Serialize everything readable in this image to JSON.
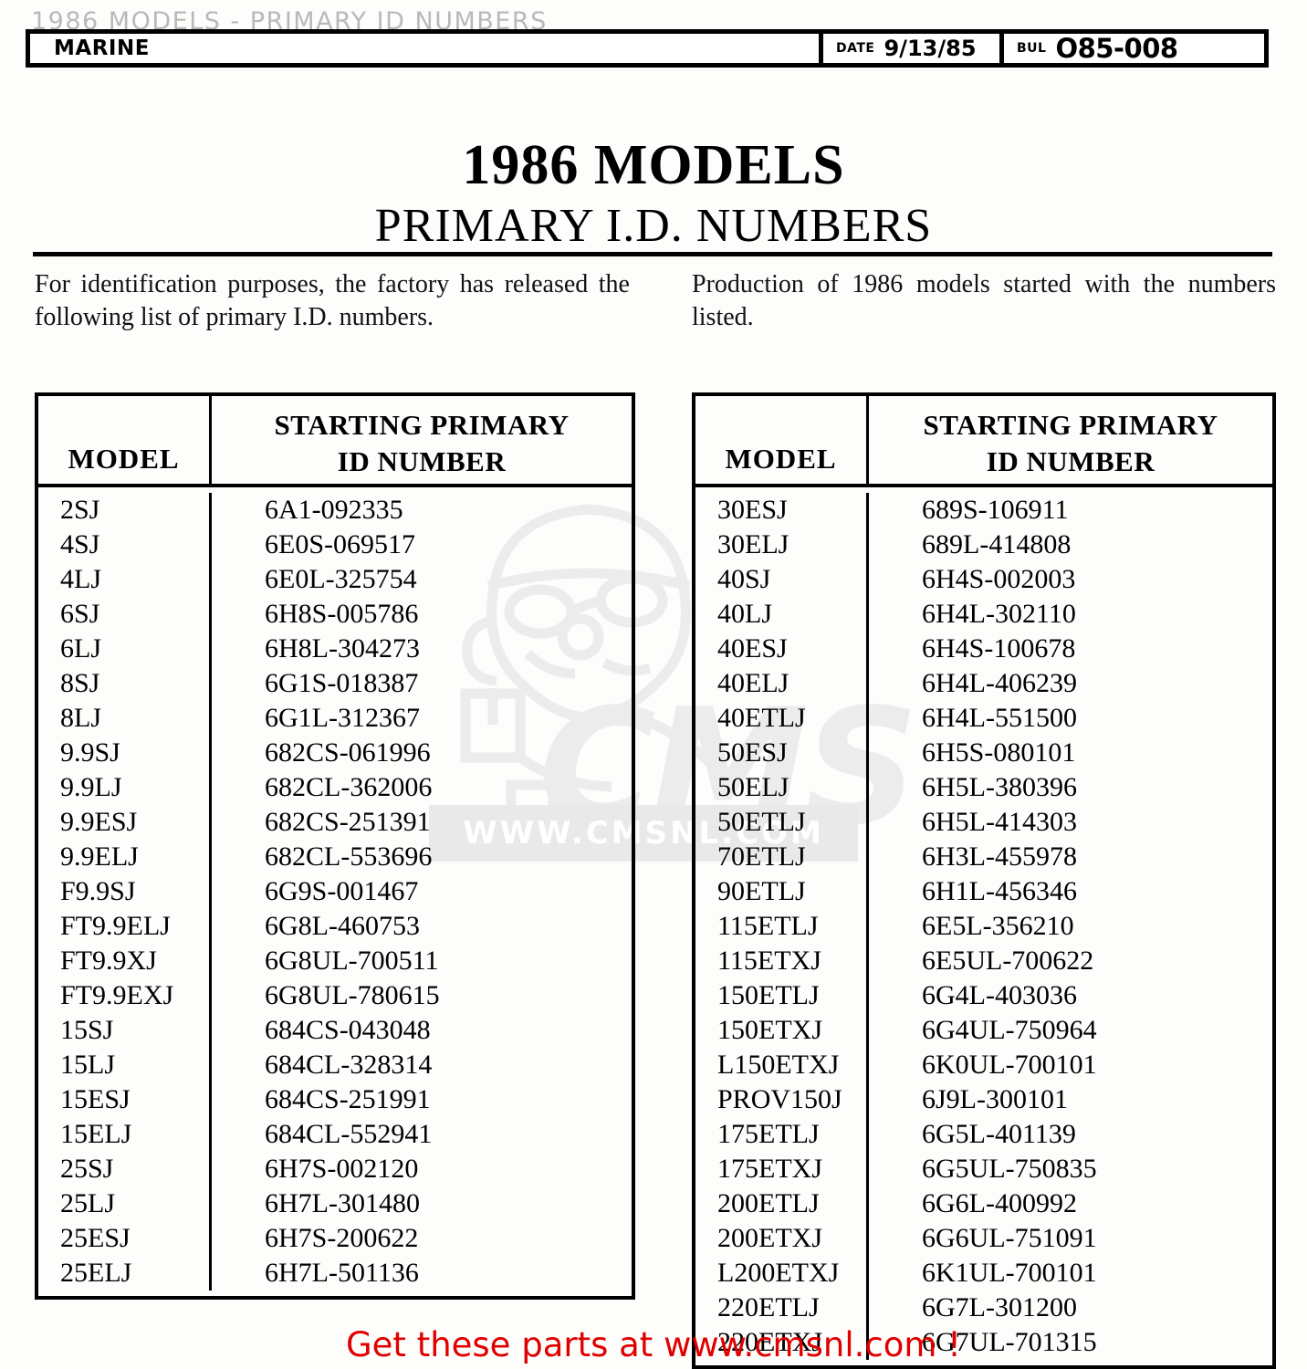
{
  "ghost_title": "1986 MODELS - PRIMARY ID NUMBERS",
  "header": {
    "division": "MARINE",
    "date_label": "DATE",
    "date_value": "9/13/85",
    "bulletin_label": "BUL",
    "bulletin_value": "O85-008"
  },
  "title": {
    "main": "1986 MODELS",
    "sub": "PRIMARY I.D. NUMBERS"
  },
  "intro": {
    "left": "For identification purposes, the factory has released the following list of primary I.D. numbers.",
    "right": "Production of 1986 models started with the numbers listed."
  },
  "table_headers": {
    "model": "MODEL",
    "id_line1": "STARTING PRIMARY",
    "id_line2": "ID NUMBER"
  },
  "left_table": [
    {
      "model": "2SJ",
      "id": "6A1-092335"
    },
    {
      "model": "4SJ",
      "id": "6E0S-069517"
    },
    {
      "model": "4LJ",
      "id": "6E0L-325754"
    },
    {
      "model": "6SJ",
      "id": "6H8S-005786"
    },
    {
      "model": "6LJ",
      "id": "6H8L-304273"
    },
    {
      "model": "8SJ",
      "id": "6G1S-018387"
    },
    {
      "model": "8LJ",
      "id": "6G1L-312367"
    },
    {
      "model": "9.9SJ",
      "id": "682CS-061996"
    },
    {
      "model": "9.9LJ",
      "id": "682CL-362006"
    },
    {
      "model": "9.9ESJ",
      "id": "682CS-251391"
    },
    {
      "model": "9.9ELJ",
      "id": "682CL-553696"
    },
    {
      "model": "F9.9SJ",
      "id": "6G9S-001467"
    },
    {
      "model": "FT9.9ELJ",
      "id": "6G8L-460753"
    },
    {
      "model": "FT9.9XJ",
      "id": "6G8UL-700511"
    },
    {
      "model": "FT9.9EXJ",
      "id": "6G8UL-780615"
    },
    {
      "model": "15SJ",
      "id": "684CS-043048"
    },
    {
      "model": "15LJ",
      "id": "684CL-328314"
    },
    {
      "model": "15ESJ",
      "id": "684CS-251991"
    },
    {
      "model": "15ELJ",
      "id": "684CL-552941"
    },
    {
      "model": "25SJ",
      "id": "6H7S-002120"
    },
    {
      "model": "25LJ",
      "id": "6H7L-301480"
    },
    {
      "model": "25ESJ",
      "id": "6H7S-200622"
    },
    {
      "model": "25ELJ",
      "id": "6H7L-501136"
    }
  ],
  "right_table": [
    {
      "model": "30ESJ",
      "id": "689S-106911"
    },
    {
      "model": "30ELJ",
      "id": "689L-414808"
    },
    {
      "model": "40SJ",
      "id": "6H4S-002003"
    },
    {
      "model": "40LJ",
      "id": "6H4L-302110"
    },
    {
      "model": "40ESJ",
      "id": "6H4S-100678"
    },
    {
      "model": "40ELJ",
      "id": "6H4L-406239"
    },
    {
      "model": "40ETLJ",
      "id": "6H4L-551500"
    },
    {
      "model": "50ESJ",
      "id": "6H5S-080101"
    },
    {
      "model": "50ELJ",
      "id": "6H5L-380396"
    },
    {
      "model": "50ETLJ",
      "id": "6H5L-414303"
    },
    {
      "model": "70ETLJ",
      "id": "6H3L-455978"
    },
    {
      "model": "90ETLJ",
      "id": "6H1L-456346"
    },
    {
      "model": "115ETLJ",
      "id": "6E5L-356210"
    },
    {
      "model": "115ETXJ",
      "id": "6E5UL-700622"
    },
    {
      "model": "150ETLJ",
      "id": "6G4L-403036"
    },
    {
      "model": "150ETXJ",
      "id": "6G4UL-750964"
    },
    {
      "model": "L150ETXJ",
      "id": "6K0UL-700101"
    },
    {
      "model": "PROV150J",
      "id": "6J9L-300101"
    },
    {
      "model": "175ETLJ",
      "id": "6G5L-401139"
    },
    {
      "model": "175ETXJ",
      "id": "6G5UL-750835"
    },
    {
      "model": "200ETLJ",
      "id": "6G6L-400992"
    },
    {
      "model": "200ETXJ",
      "id": "6G6UL-751091"
    },
    {
      "model": "L200ETXJ",
      "id": "6K1UL-700101"
    },
    {
      "model": "220ETLJ",
      "id": "6G7L-301200"
    },
    {
      "model": "220ETXJ",
      "id": "6G7UL-701315"
    }
  ],
  "watermark": {
    "band_text": "WWW.CMSNL.COM",
    "logo_text": "CMS"
  },
  "promo": "Get these parts at www.cmsnl.com !",
  "colors": {
    "ink": "#000000",
    "promo_red": "#e00000",
    "watermark_grey": "#ececec"
  }
}
